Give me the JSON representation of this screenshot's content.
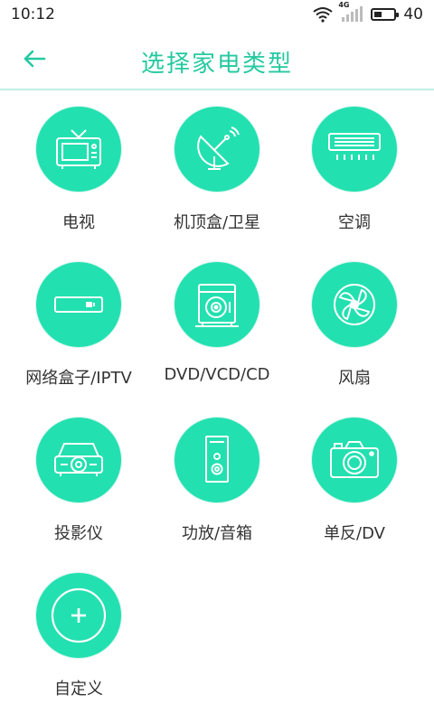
{
  "status_bar": {
    "time": "10:12",
    "network": "4G",
    "battery": "40",
    "battery_level": 0.4
  },
  "header": {
    "back_icon": "arrow-left-icon",
    "title": "选择家电类型"
  },
  "colors": {
    "accent": "#25c9a0",
    "circle": "#23e0b0",
    "divider": "#bfeee2"
  },
  "devices": [
    {
      "label": "电视",
      "icon": "tv-icon"
    },
    {
      "label": "机顶盒/卫星",
      "icon": "satellite-dish-icon"
    },
    {
      "label": "空调",
      "icon": "air-conditioner-icon"
    },
    {
      "label": "网络盒子/IPTV",
      "icon": "network-box-icon"
    },
    {
      "label": "DVD/VCD/CD",
      "icon": "dvd-player-icon"
    },
    {
      "label": "风扇",
      "icon": "fan-icon"
    },
    {
      "label": "投影仪",
      "icon": "projector-icon"
    },
    {
      "label": "功放/音箱",
      "icon": "speaker-icon"
    },
    {
      "label": "单反/DV",
      "icon": "camera-icon"
    },
    {
      "label": "自定义",
      "icon": "plus-icon"
    }
  ]
}
